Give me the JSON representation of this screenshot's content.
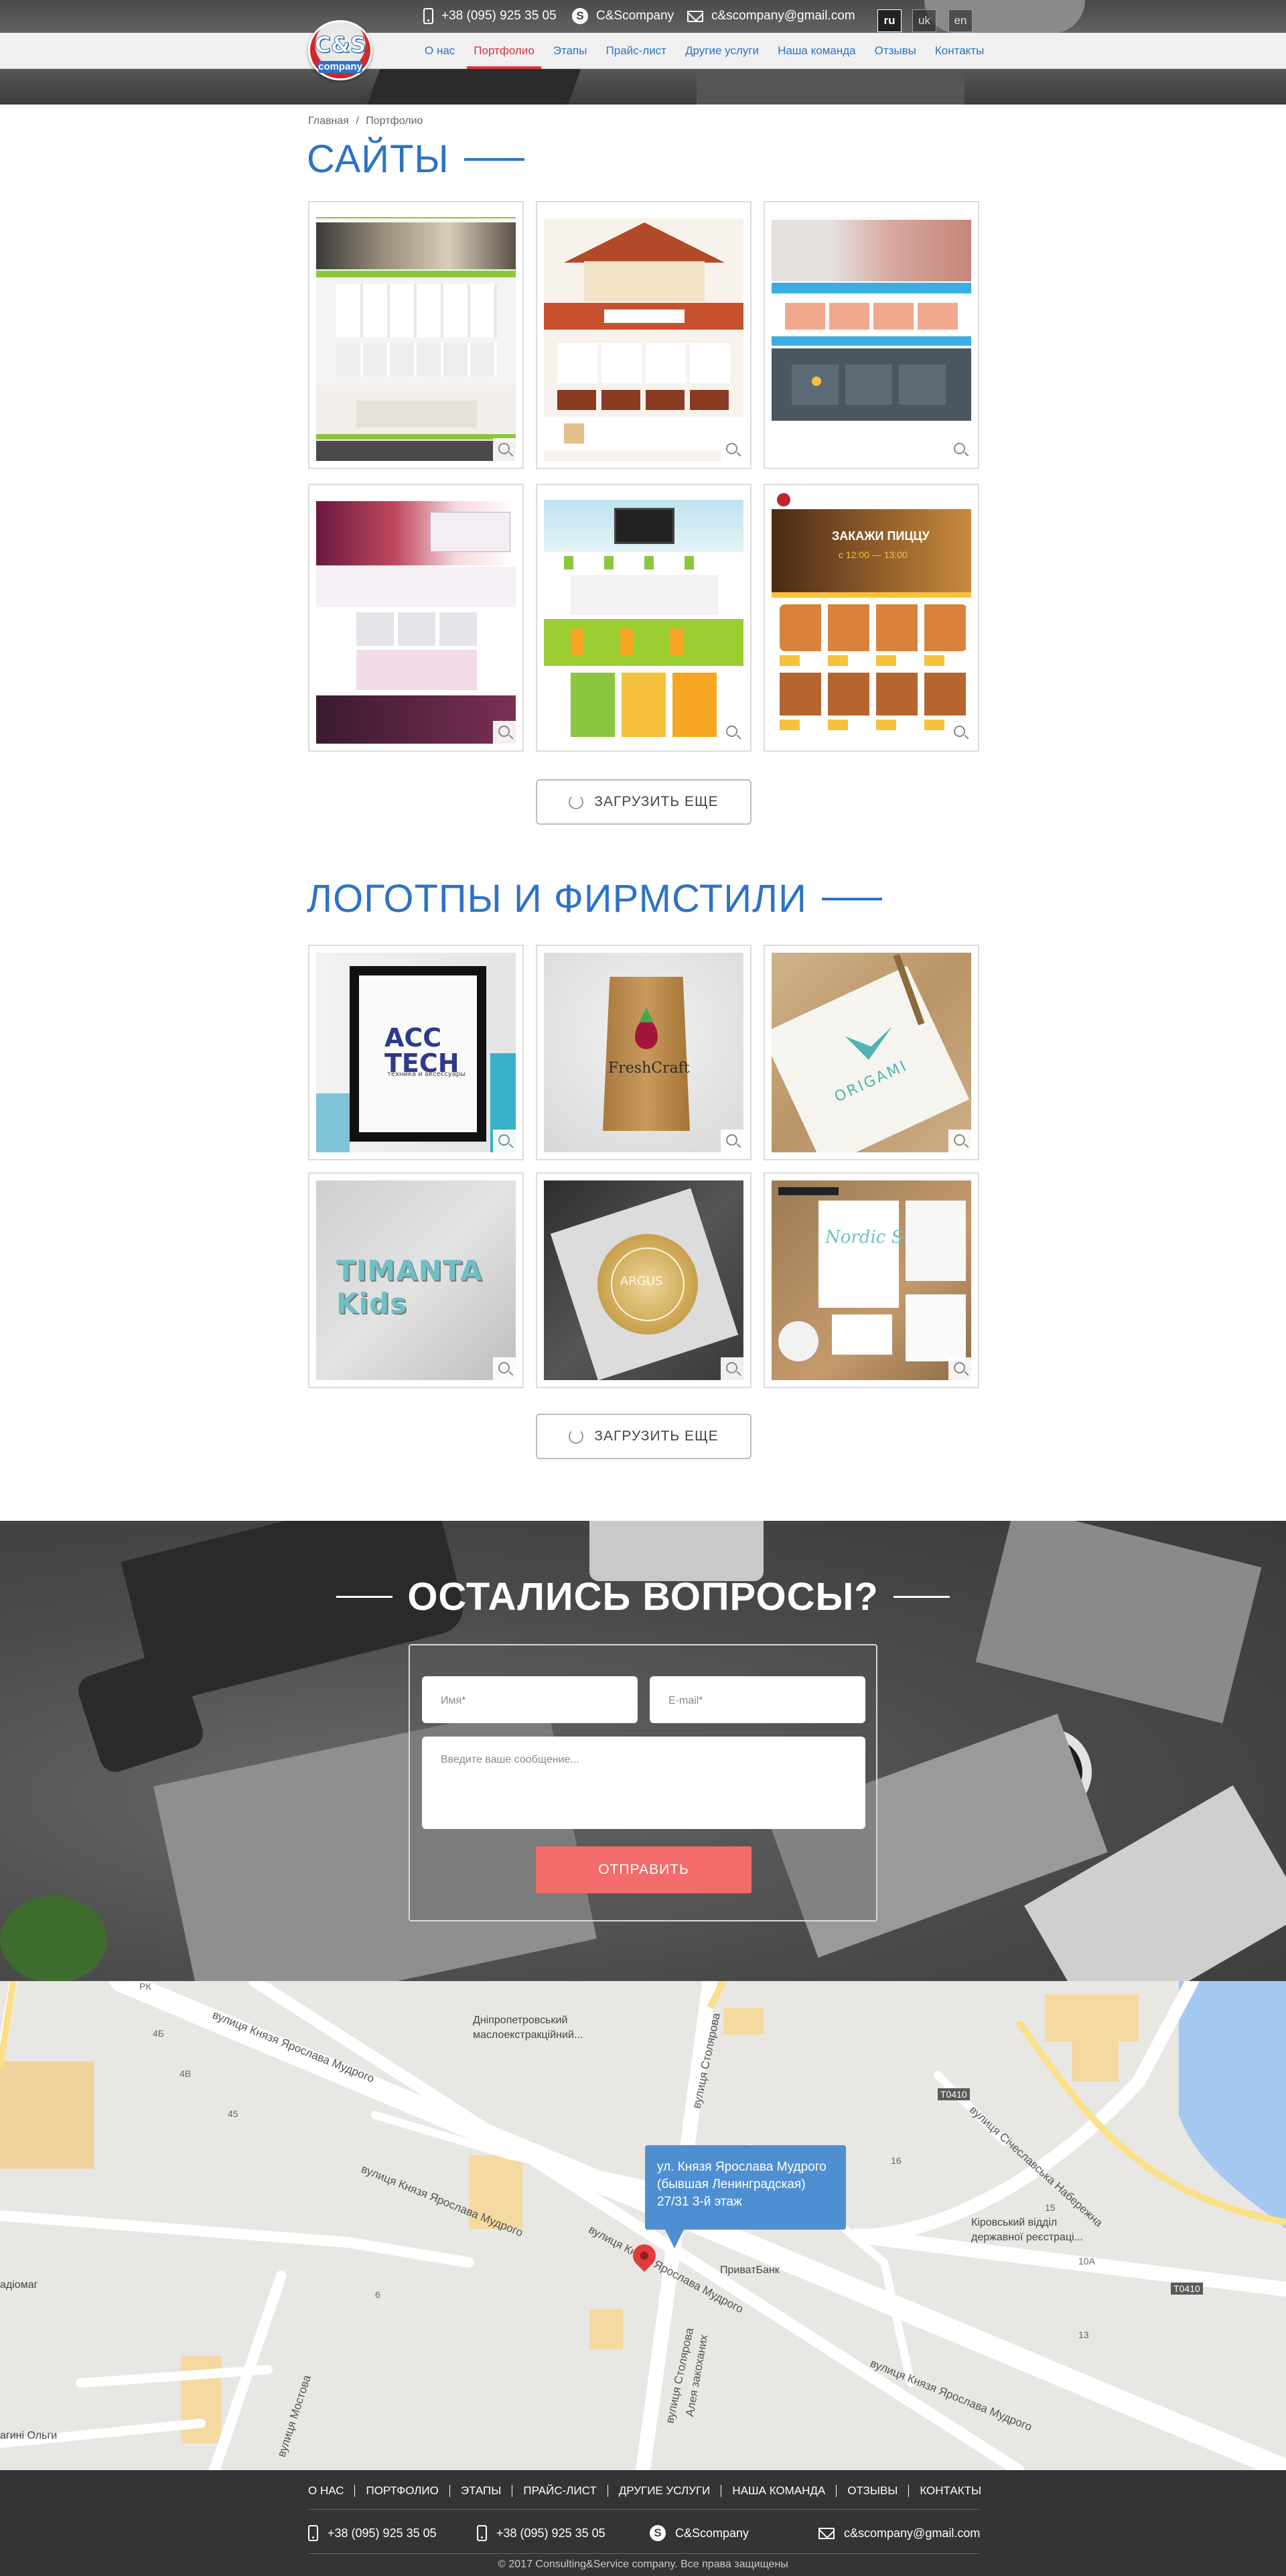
{
  "header": {
    "phone": "+38 (095) 925 35 05",
    "skype": "C&Scompany",
    "email": "c&scompany@gmail.com",
    "languages": [
      "ru",
      "uk",
      "en"
    ],
    "active_language": "ru",
    "logo_text": "C&S",
    "logo_sub": "company",
    "nav": [
      "О нас",
      "Портфолио",
      "Этапы",
      "Прайс-лист",
      "Другие услуги",
      "Наша команда",
      "Отзывы",
      "Контакты"
    ],
    "active_nav": "Портфолио"
  },
  "breadcrumb": [
    "Главная",
    "/",
    "Портфолио"
  ],
  "sites": {
    "title": "САЙТЫ",
    "load_more": "ЗАГРУЗИТЬ ЕЩЕ"
  },
  "logos": {
    "title": "ЛОГОТПЫ И ФИРМСТИЛИ",
    "load_more": "ЗАГРУЗИТЬ ЕЩЕ",
    "tiles": [
      "ACC TECH",
      "FreshCraft",
      "ORIGAMI",
      "TIMANTA Kids",
      "ARGUS",
      "Nordic Silk"
    ],
    "acc_tagline": "техника и аксессуары"
  },
  "site_mock": {
    "pizza_banner": "ЗАКАЖИ ПИЦЦУ",
    "pizza_time": "с 12:00 — 13:00"
  },
  "questions": {
    "title": "ОСТАЛИСЬ ВОПРОСЫ?",
    "name_placeholder": "Имя*",
    "email_placeholder": "E-mail*",
    "message_placeholder": "Введите ваше сообщение...",
    "submit": "ОТПРАВИТЬ"
  },
  "map": {
    "tooltip_line1": "ул. Князя Ярослава Мудрого",
    "tooltip_line2": "(бывшая Ленинградская)",
    "tooltip_line3": "27/31 3-й этаж",
    "labels": {
      "poi1_l1": "Дніпропетровський",
      "poi1_l2": "маслоекстракційний...",
      "bank": "ПриватБанк",
      "office_l1": "Кіровський відділ",
      "office_l2": "державної реєстраці...",
      "street_main": "вулиця Князя Ярослава Мудрого",
      "street_main2": "вулиця Князя Ярослава Мудрого",
      "street_main3": "вулиця Князя Ярослава Мудрого",
      "street_main4": "вулиця Князя Ярослава Мудрого",
      "street_stolyarova": "вулиця Столярова",
      "street_stolyarova2": "вулиця Столярова",
      "embankment": "вулиця Січеславська Набережна",
      "alley": "Алея закоханих",
      "mostova": "вулиця Мостова",
      "olgi": "агині Ольги",
      "radiomag": "адіомаг",
      "road1": "T0410",
      "road2": "T0410",
      "num_rk": "РК",
      "num_4b": "4Б",
      "num_4v": "4В",
      "num_6": "6",
      "num_45": "45",
      "num_10a": "10А",
      "num_13": "13",
      "num_16": "16",
      "num_15": "15"
    }
  },
  "footer": {
    "nav": [
      "О НАС",
      "ПОРТФОЛИО",
      "ЭТАПЫ",
      "ПРАЙС-ЛИСТ",
      "ДРУГИЕ УСЛУГИ",
      "НАША КОМАНДА",
      "ОТЗЫВЫ",
      "КОНТАКТЫ"
    ],
    "phone1": "+38 (095) 925 35 05",
    "phone2": "+38 (095) 925 35 05",
    "skype": "C&Scompany",
    "email": "c&scompany@gmail.com",
    "copyright": "© 2017 Consulting&Service company. Все права защищены"
  }
}
